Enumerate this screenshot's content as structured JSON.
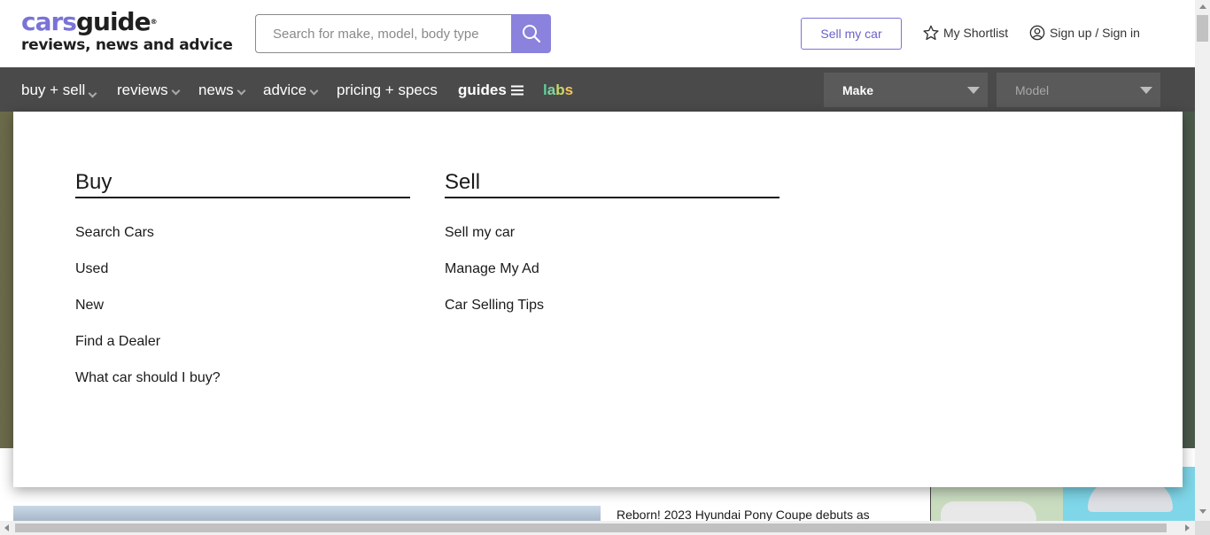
{
  "header": {
    "logo": {
      "part1": "cars",
      "part2": "guide",
      "reg": "®",
      "tagline": "reviews, news and advice"
    },
    "search": {
      "placeholder": "Search for make, model, body type",
      "icon": "search-icon"
    },
    "sell_button": "Sell my car",
    "shortlist": {
      "label": "My Shortlist",
      "icon": "star-icon"
    },
    "signin": {
      "label": "Sign up / Sign in",
      "icon": "user-circle-icon"
    }
  },
  "nav": {
    "items": [
      {
        "label": "buy + sell"
      },
      {
        "label": "reviews"
      },
      {
        "label": "news"
      },
      {
        "label": "advice"
      },
      {
        "label": "pricing + specs"
      },
      {
        "label": "guides",
        "icon": "hamburger-icon"
      }
    ],
    "labs": {
      "l1": "l",
      "l2": "a",
      "l3": "b",
      "l4": "s"
    },
    "make_select": {
      "label": "Make"
    },
    "model_select": {
      "label": "Model"
    }
  },
  "menu": {
    "buy": {
      "title": "Buy",
      "items": [
        "Search Cars",
        "Used",
        "New",
        "Find a Dealer",
        "What car should I buy?"
      ]
    },
    "sell": {
      "title": "Sell",
      "items": [
        "Sell my car",
        "Manage My Ad",
        "Car Selling Tips"
      ]
    }
  },
  "background": {
    "headline": "Reborn! 2023 Hyundai Pony Coupe debuts as"
  },
  "colors": {
    "brand_purple": "#7a73d6",
    "nav_bg": "#4a4a4a",
    "search_button": "#8a82dd"
  }
}
